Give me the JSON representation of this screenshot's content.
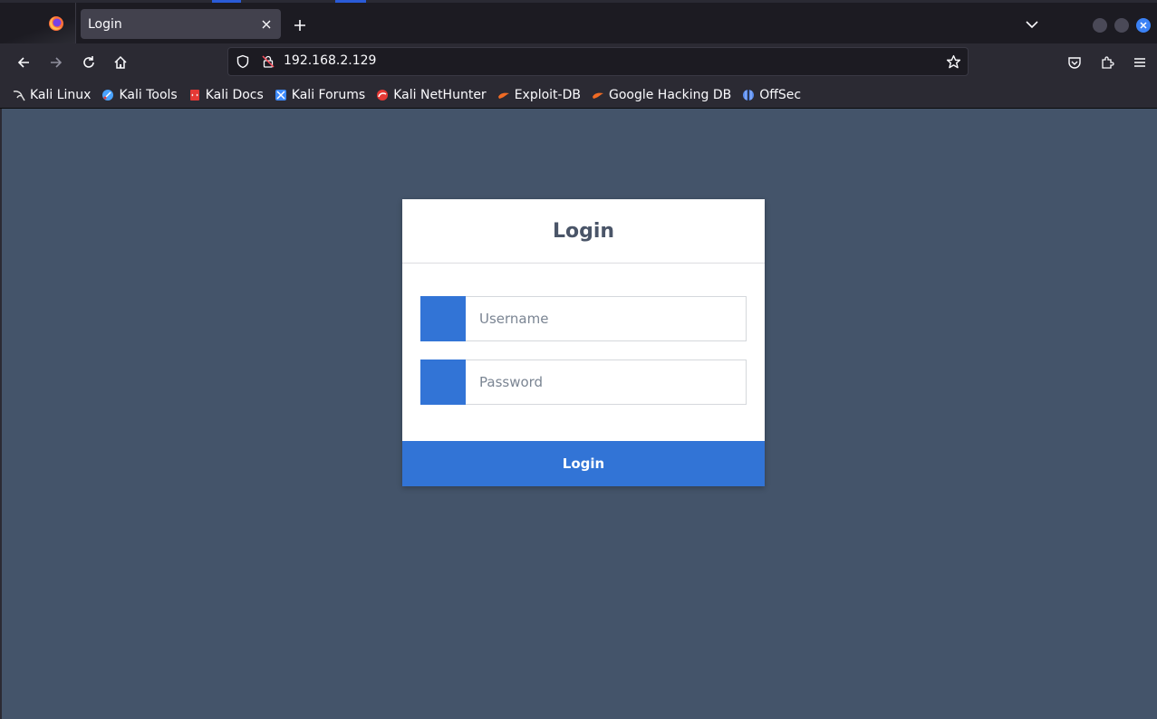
{
  "browser": {
    "tab": {
      "title": "Login"
    },
    "url": "192.168.2.129",
    "bookmarks": [
      {
        "label": "Kali Linux",
        "icon": "kali-dragon-icon",
        "color": "#e0e0e0"
      },
      {
        "label": "Kali Tools",
        "icon": "kali-tools-icon",
        "color": "#4aa3ff"
      },
      {
        "label": "Kali Docs",
        "icon": "kali-docs-icon",
        "color": "#e53935"
      },
      {
        "label": "Kali Forums",
        "icon": "kali-forums-icon",
        "color": "#3d8bff"
      },
      {
        "label": "Kali NetHunter",
        "icon": "kali-nethunter-icon",
        "color": "#e53935"
      },
      {
        "label": "Exploit-DB",
        "icon": "exploit-db-icon",
        "color": "#f06b24"
      },
      {
        "label": "Google Hacking DB",
        "icon": "ghdb-icon",
        "color": "#f06b24"
      },
      {
        "label": "OffSec",
        "icon": "offsec-icon",
        "color": "#5a8dee"
      }
    ]
  },
  "login": {
    "title": "Login",
    "username_placeholder": "Username",
    "password_placeholder": "Password",
    "submit_label": "Login"
  },
  "colors": {
    "page_background": "#44546a",
    "accent": "#3274d6"
  }
}
